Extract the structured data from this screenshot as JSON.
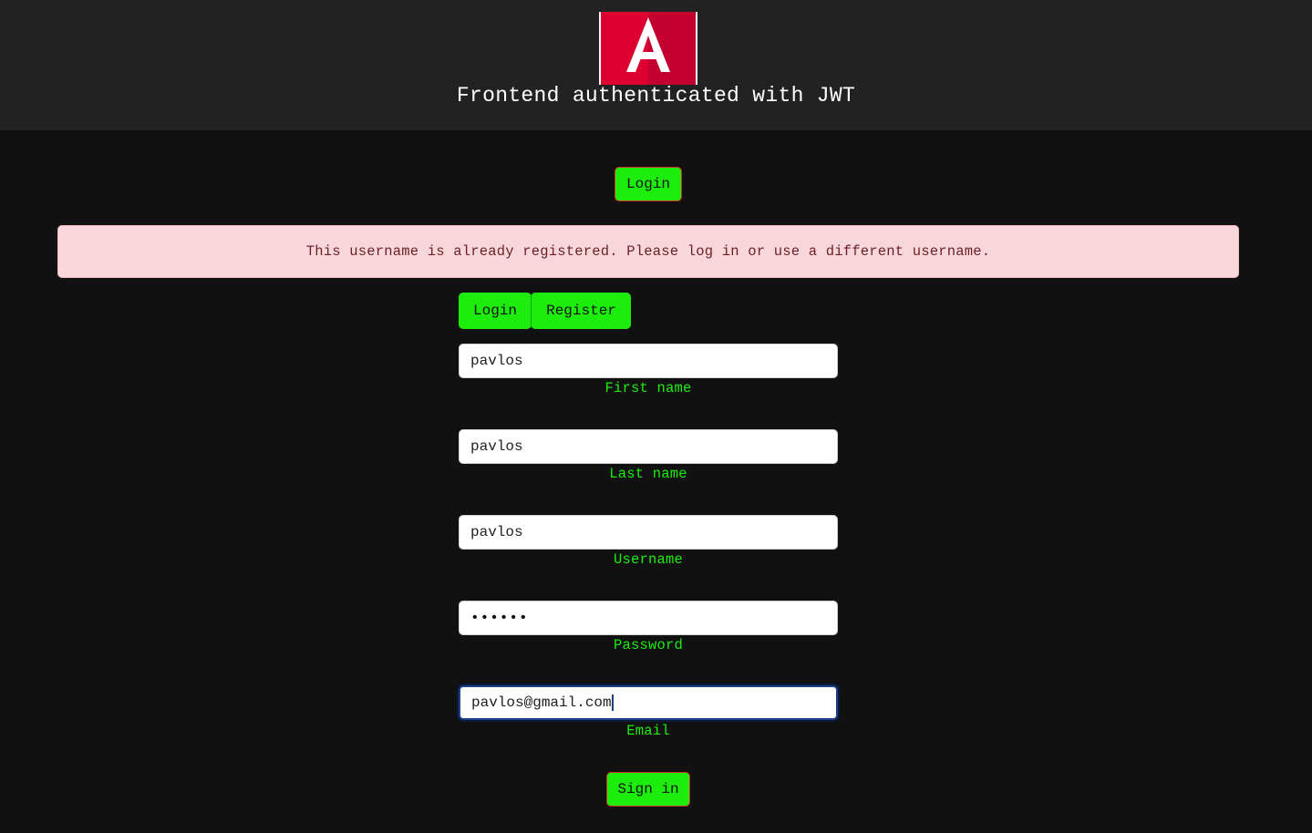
{
  "header": {
    "logo_icon": "angular-logo-icon",
    "title": "Frontend authenticated with JWT"
  },
  "nav": {
    "login_label": "Login"
  },
  "alert": {
    "message": "This username is already registered. Please log in or use a different username."
  },
  "tabs": [
    {
      "label": "Login"
    },
    {
      "label": "Register"
    }
  ],
  "form": {
    "first_name": {
      "value": "pavlos",
      "label": "First name"
    },
    "last_name": {
      "value": "pavlos",
      "label": "Last name"
    },
    "username": {
      "value": "pavlos",
      "label": "Username"
    },
    "password": {
      "value": "••••••",
      "label": "Password"
    },
    "email": {
      "value": "pavlos@gmail.com",
      "label": "Email"
    },
    "submit_label": "Sign in"
  },
  "colors": {
    "accent_green": "#1ded0d",
    "alert_bg": "#f7d7da",
    "angular_red": "#dd0031"
  }
}
